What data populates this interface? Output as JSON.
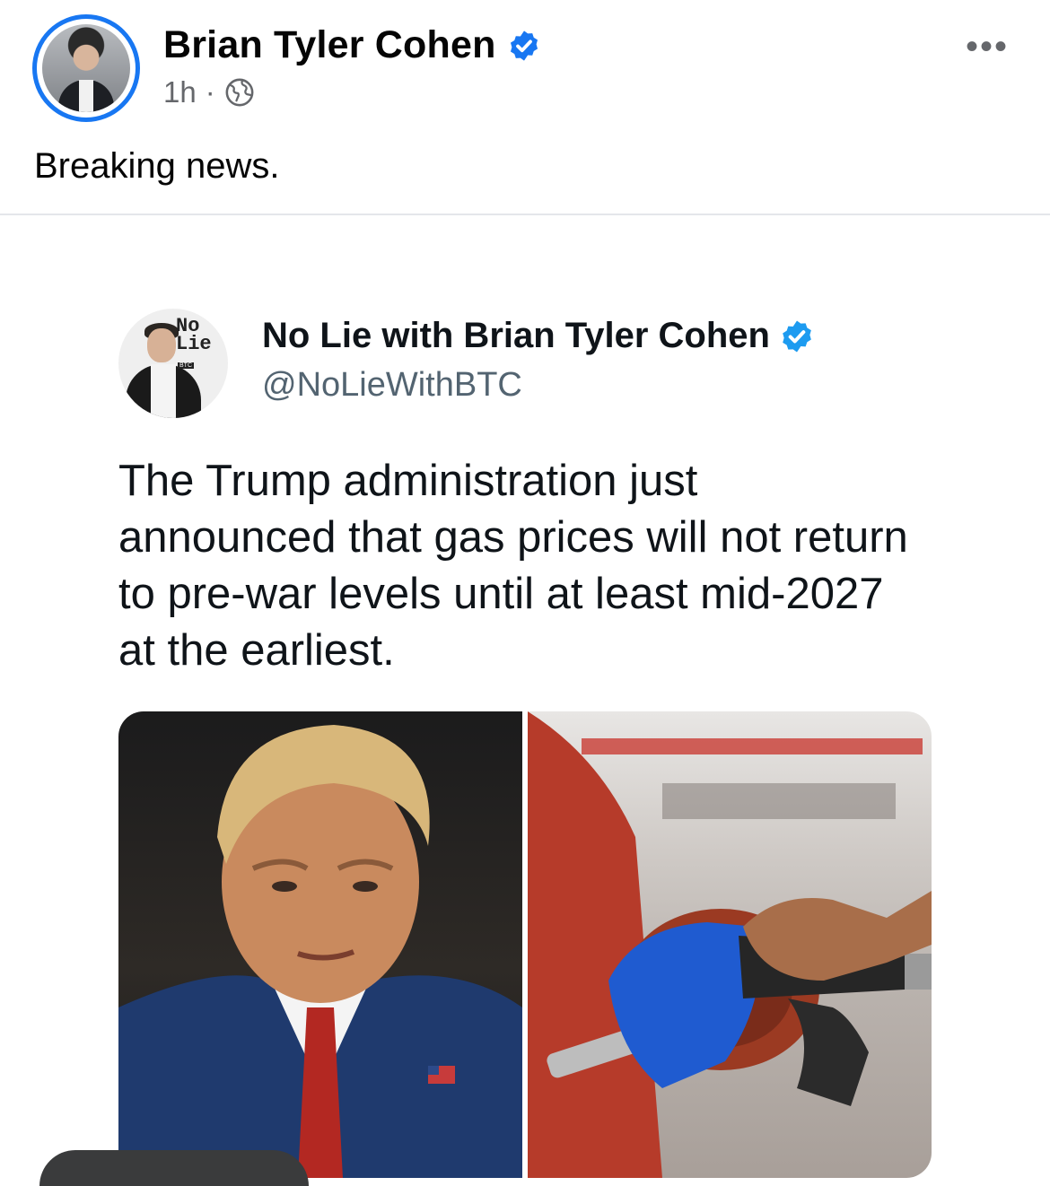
{
  "post": {
    "author": "Brian Tyler Cohen",
    "time": "1h",
    "separator": "·",
    "text": "Breaking news."
  },
  "tweet": {
    "name": "No Lie with Brian Tyler Cohen",
    "handle": "@NoLieWithBTC",
    "avatar_logo_line1": "No",
    "avatar_logo_line2": "Lie",
    "avatar_logo_tag": "BTC",
    "body": "The Trump administration just announced that gas prices will not return to pre-war levels until at least mid-2027 at the earliest."
  },
  "colors": {
    "verified": "#1877f2",
    "secondary_text": "#65676b",
    "divider": "#e4e6eb"
  },
  "icons": {
    "verified": "verified-badge-icon",
    "audience": "globe-icon",
    "more": "more-options-icon"
  }
}
